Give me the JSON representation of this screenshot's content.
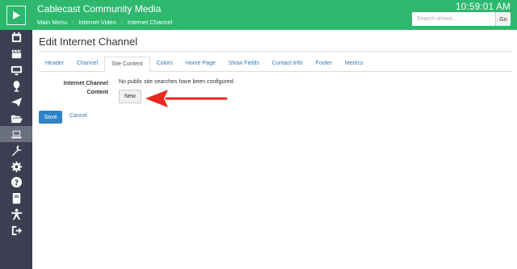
{
  "header": {
    "app_title": "Cablecast Community Media",
    "clock": "10:59:01 AM",
    "breadcrumb": [
      "Main Menu",
      "Internet Video",
      "Internet Channel"
    ],
    "search": {
      "placeholder": "Search shows...",
      "button_label": "Go"
    }
  },
  "sidebar": {
    "items": [
      {
        "icon": "calendar-icon"
      },
      {
        "icon": "clapperboard-icon"
      },
      {
        "icon": "tv-monitor-icon"
      },
      {
        "icon": "microphone-icon"
      },
      {
        "icon": "send-icon"
      },
      {
        "icon": "folder-open-icon"
      },
      {
        "icon": "laptop-icon",
        "active": true
      },
      {
        "icon": "wrench-icon"
      },
      {
        "icon": "gear-icon"
      },
      {
        "icon": "question-icon"
      },
      {
        "icon": "book-icon"
      },
      {
        "icon": "user-accessibility-icon"
      },
      {
        "icon": "sign-out-icon"
      }
    ]
  },
  "main": {
    "page_title": "Edit Internet Channel",
    "tabs": [
      "Header",
      "Channel",
      "Site Content",
      "Colors",
      "Home Page",
      "Show Fields",
      "Contact Info",
      "Footer",
      "Metrics"
    ],
    "active_tab": "Site Content",
    "field_label": "Internet Channel Content",
    "field_note": "No public site searches have been configured.",
    "new_button": "New",
    "save_button": "Save",
    "cancel_link": "Cancel"
  },
  "colors": {
    "accent_green": "#2eb86e",
    "sidebar_bg": "#3b3f51",
    "primary_blue": "#2f84c7",
    "annotation_red": "#e8281e"
  }
}
